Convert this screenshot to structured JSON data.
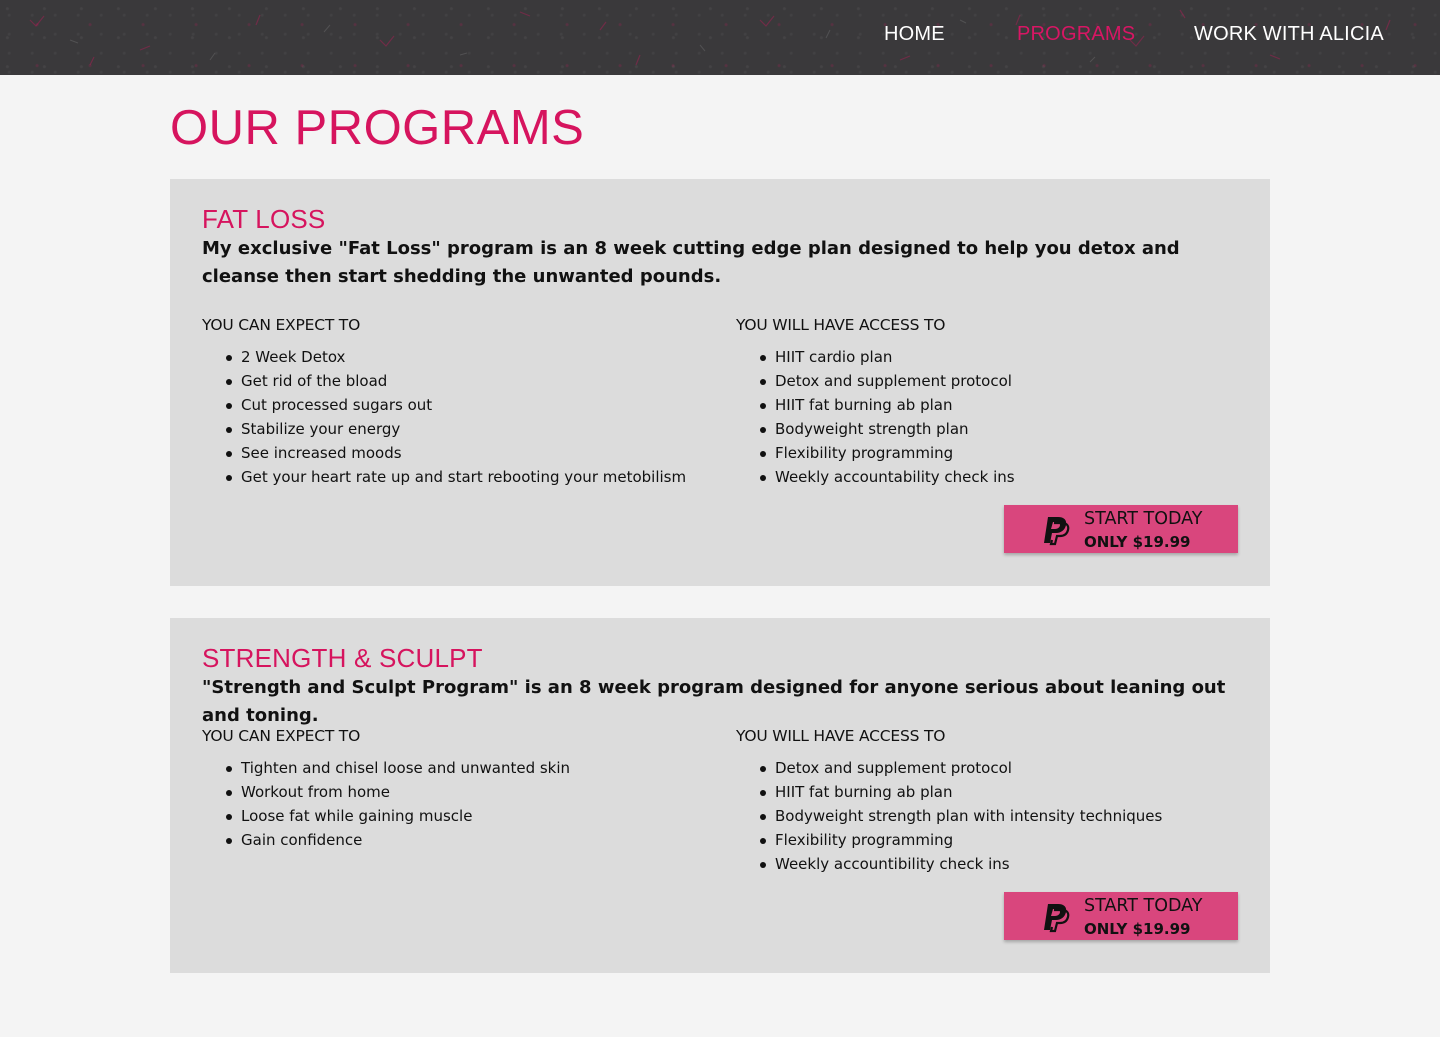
{
  "nav": {
    "items": [
      {
        "label": "HOME"
      },
      {
        "label": "PROGRAMS"
      },
      {
        "label": "WORK WITH ALICIA"
      }
    ],
    "active": "PROGRAMS",
    "accent_color": "#d6145e"
  },
  "page": {
    "title": "OUR PROGRAMS"
  },
  "programs": [
    {
      "title": "FAT LOSS",
      "description": "My exclusive \"Fat Loss\" program is an 8 week cutting edge plan designed to help you detox and cleanse then start shedding the unwanted pounds.",
      "expect_heading": "YOU CAN EXPECT TO",
      "expect_items": [
        "2 Week Detox",
        "Get rid of the bload",
        "Cut processed sugars out",
        "Stabilize your energy",
        "See increased moods",
        "Get your heart rate up and start rebooting your metobilism"
      ],
      "access_heading": "YOU WILL HAVE ACCESS TO",
      "access_items": [
        "HIIT cardio plan",
        "Detox and supplement protocol",
        "HIIT fat burning ab plan",
        "Bodyweight strength plan",
        "Flexibility programming",
        "Weekly accountability check ins"
      ],
      "cta_label": "START TODAY",
      "cta_price": "ONLY $19.99",
      "cta_icon": "paypal-icon"
    },
    {
      "title": "STRENGTH & SCULPT",
      "description": "\"Strength and Sculpt Program\" is an 8 week program designed for anyone serious about leaning out and toning.",
      "expect_heading": "YOU CAN EXPECT TO",
      "expect_items": [
        "Tighten and chisel loose and unwanted skin",
        "Workout from home",
        "Loose fat while gaining muscle",
        "Gain confidence"
      ],
      "access_heading": "YOU WILL HAVE ACCESS TO",
      "access_items": [
        "Detox and supplement protocol",
        "HIIT fat burning ab plan",
        "Bodyweight strength plan with intensity techniques",
        "Flexibility programming",
        "Weekly accountibility check ins"
      ],
      "cta_label": "START TODAY",
      "cta_price": "ONLY $19.99",
      "cta_icon": "paypal-icon"
    }
  ],
  "colors": {
    "header_bg": "#3a393b",
    "card_bg": "#dcdcdc",
    "cta_bg": "#d9467d",
    "page_bg": "#f4f4f4"
  }
}
